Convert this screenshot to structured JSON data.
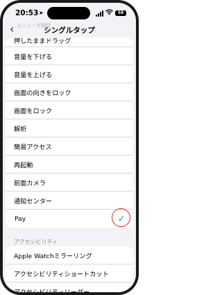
{
  "status_bar": {
    "time": "20:53",
    "battery": "58"
  },
  "nav": {
    "ghost_label": "メニューを開閉",
    "title": "シングルタップ",
    "back_glyph": "‹"
  },
  "actions": [
    {
      "label": "押したままドラッグ"
    },
    {
      "label": "音量を下げる"
    },
    {
      "label": "音量を上げる"
    },
    {
      "label": "画面の向きをロック"
    },
    {
      "label": "画面をロック"
    },
    {
      "label": "解析"
    },
    {
      "label": "簡易アクセス"
    },
    {
      "label": "再起動"
    },
    {
      "label": "前面カメラ"
    },
    {
      "label": "通知センター"
    },
    {
      "label": "Pay",
      "prefix": "",
      "selected": true,
      "checkmark": "✓"
    }
  ],
  "accessibility": {
    "header": "アクセシビリティ",
    "items": [
      {
        "label": "Apple Watchミラーリング"
      },
      {
        "label": "アクセシビリティショートカット"
      },
      {
        "label": "アクセシビリティリーダー"
      }
    ]
  },
  "colors": {
    "accent": "#0a84ff",
    "highlight": "#e02020",
    "background": "#f2f2f7"
  }
}
